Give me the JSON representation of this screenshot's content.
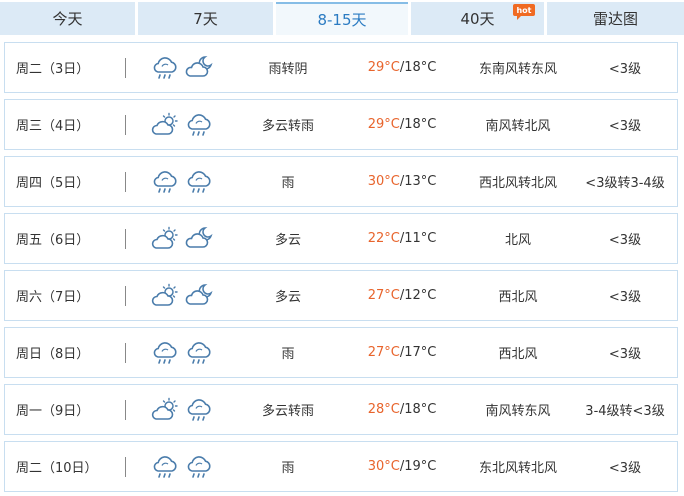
{
  "tabs": [
    {
      "label": "今天"
    },
    {
      "label": "7天"
    },
    {
      "label": "8-15天"
    },
    {
      "label": "40天"
    },
    {
      "label": "雷达图"
    }
  ],
  "hot_badge": "hot",
  "colors": {
    "tab_bg": "#dceaf6",
    "active_tab_text": "#2b7bc2",
    "high_temp": "#e8642c",
    "row_border": "#c8def0"
  },
  "days": [
    {
      "day": "周二（3日）",
      "icons": [
        "rain-cloud-icon",
        "moon-cloud-icon"
      ],
      "desc": "雨转阴",
      "high": "29°C",
      "low": "/18°C",
      "wind": "东南风转东风",
      "level": "<3级"
    },
    {
      "day": "周三（4日）",
      "icons": [
        "sun-cloud-icon",
        "rain-cloud-icon"
      ],
      "desc": "多云转雨",
      "high": "29°C",
      "low": "/18°C",
      "wind": "南风转北风",
      "level": "<3级"
    },
    {
      "day": "周四（5日）",
      "icons": [
        "rain-cloud-icon",
        "rain-cloud-icon"
      ],
      "desc": "雨",
      "high": "30°C",
      "low": "/13°C",
      "wind": "西北风转北风",
      "level": "<3级转3-4级"
    },
    {
      "day": "周五（6日）",
      "icons": [
        "sun-cloud-icon",
        "moon-cloud-icon"
      ],
      "desc": "多云",
      "high": "22°C",
      "low": "/11°C",
      "wind": "北风",
      "level": "<3级"
    },
    {
      "day": "周六（7日）",
      "icons": [
        "sun-cloud-icon",
        "moon-cloud-icon"
      ],
      "desc": "多云",
      "high": "27°C",
      "low": "/12°C",
      "wind": "西北风",
      "level": "<3级"
    },
    {
      "day": "周日（8日）",
      "icons": [
        "rain-cloud-icon",
        "rain-cloud-icon"
      ],
      "desc": "雨",
      "high": "27°C",
      "low": "/17°C",
      "wind": "西北风",
      "level": "<3级"
    },
    {
      "day": "周一（9日）",
      "icons": [
        "sun-cloud-icon",
        "rain-cloud-icon"
      ],
      "desc": "多云转雨",
      "high": "28°C",
      "low": "/18°C",
      "wind": "南风转东风",
      "level": "3-4级转<3级"
    },
    {
      "day": "周二（10日）",
      "icons": [
        "rain-cloud-icon",
        "rain-cloud-icon"
      ],
      "desc": "雨",
      "high": "30°C",
      "low": "/19°C",
      "wind": "东北风转北风",
      "level": "<3级"
    }
  ]
}
